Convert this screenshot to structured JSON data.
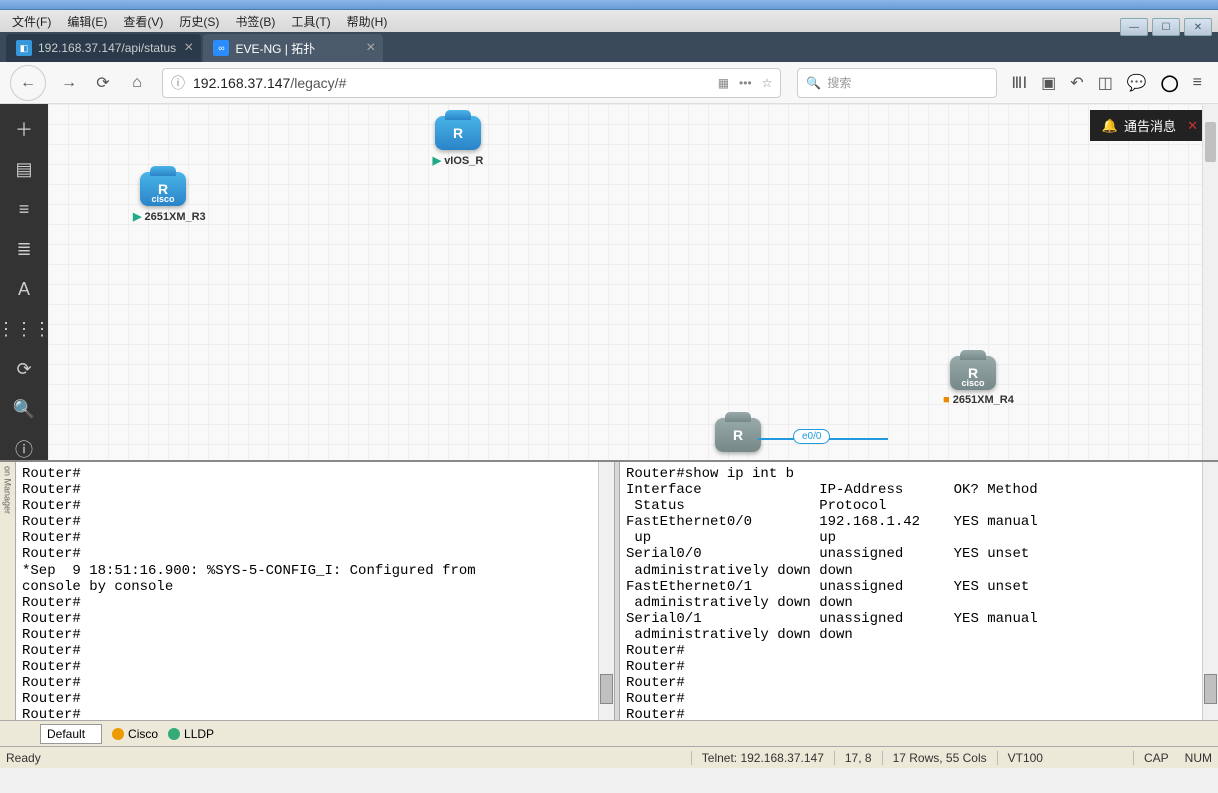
{
  "menubar": [
    "文件(F)",
    "编辑(E)",
    "查看(V)",
    "历史(S)",
    "书签(B)",
    "工具(T)",
    "帮助(H)"
  ],
  "tabs": [
    {
      "title": "192.168.37.147/api/status",
      "active": false
    },
    {
      "title": "EVE-NG | 拓扑",
      "active": true
    }
  ],
  "url": {
    "host": "192.168.37.147",
    "path": "/legacy/#"
  },
  "search": {
    "placeholder": "搜索"
  },
  "notification": {
    "label": "通告消息"
  },
  "nodes": {
    "r3": {
      "label": "2651XM_R3",
      "status": "run",
      "type": "cisco"
    },
    "vios": {
      "label": "vIOS_R",
      "status": "run",
      "type": "R"
    },
    "r4": {
      "label": "2651XM_R4",
      "status": "stop",
      "type": "cisco"
    },
    "r_center": {
      "label": "",
      "status": "stop",
      "type": "R",
      "iface": "e0/0"
    }
  },
  "termLeft": "Router#\nRouter#\nRouter#\nRouter#\nRouter#\nRouter#\n*Sep  9 18:51:16.900: %SYS-5-CONFIG_I: Configured from\nconsole by console\nRouter#\nRouter#\nRouter#\nRouter#\nRouter#\nRouter#\nRouter#\nRouter#",
  "termRight": "Router#show ip int b\nInterface              IP-Address      OK? Method\n Status                Protocol\nFastEthernet0/0        192.168.1.42    YES manual\n up                    up\nSerial0/0              unassigned      YES unset\n administratively down down\nFastEthernet0/1        unassigned      YES unset\n administratively down down\nSerial0/1              unassigned      YES manual\n administratively down down\nRouter#\nRouter#\nRouter#\nRouter#\nRouter#",
  "bottomBar": {
    "default": "Default",
    "cisco": "Cisco",
    "lldp": "LLDP"
  },
  "status": {
    "ready": "Ready",
    "conn": "Telnet: 192.168.37.147",
    "pos": "17,   8",
    "size": "17 Rows, 55 Cols",
    "term": "VT100",
    "cap": "CAP",
    "num": "NUM"
  },
  "sidebarIcons": [
    "＋",
    "▤",
    "≡",
    "≣",
    "A",
    "⋮⋮⋮",
    "⟳",
    "🔍",
    "ⓘ"
  ],
  "termSideManager": "on Manager"
}
